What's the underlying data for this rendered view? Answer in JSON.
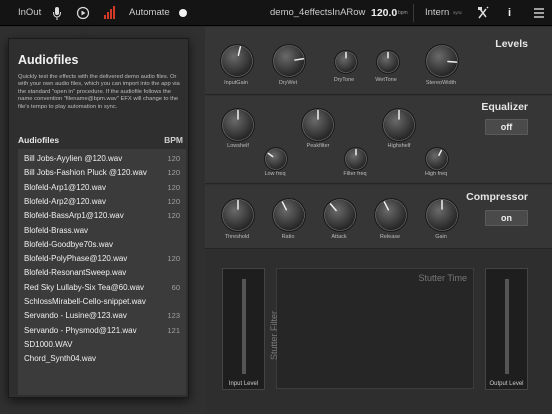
{
  "topbar": {
    "inout": "InOut",
    "automate": "Automate",
    "project": "demo_4effectsInARow",
    "bpm_value": "120.0",
    "bpm_unit": "bpm",
    "sync_label": "Intern",
    "sync_sub": "sync",
    "info": "i",
    "colors": {
      "record": "#d23a2a",
      "bar": "#141414"
    }
  },
  "levels": {
    "title": "Levels",
    "knobs": [
      {
        "label": "InputGain",
        "value": 0.55
      },
      {
        "label": "DryWet",
        "value": 0.8
      },
      {
        "label": "DryTone",
        "value": 0.5
      },
      {
        "label": "WetTone",
        "value": 0.5
      },
      {
        "label": "StereoWidth",
        "value": 0.85
      }
    ]
  },
  "equalizer": {
    "title": "Equalizer",
    "toggle": "off",
    "knobs": [
      {
        "label": "Lowshelf",
        "value": 0.5
      },
      {
        "label": "Peakfilter",
        "value": 0.5
      },
      {
        "label": "Highshelf",
        "value": 0.5
      },
      {
        "label": "Low freq",
        "value": 0.3
      },
      {
        "label": "Filter freq",
        "value": 0.5
      },
      {
        "label": "High freq",
        "value": 0.6
      }
    ]
  },
  "compressor": {
    "title": "Compressor",
    "toggle": "on",
    "knobs": [
      {
        "label": "Threshold",
        "value": 0.5
      },
      {
        "label": "Ratio",
        "value": 0.4
      },
      {
        "label": "Attack",
        "value": 0.35
      },
      {
        "label": "Release",
        "value": 0.4
      },
      {
        "label": "Gain",
        "value": 0.5
      }
    ]
  },
  "stutter": {
    "time_label": "Stutter Time",
    "filter_label": "Stutter Filter",
    "input_level": "Input Level",
    "output_level": "Output Level"
  },
  "audiofiles": {
    "title": "Audiofiles",
    "description": "Quickly test the effects with the delivered demo audio files. Or with your own audio files, which you can import into the app via the standard \"open in\" procedure. If the audiofile follows the name convention \"filename@bpm.wav\" EFX will change to the file's tempo to play automation in sync.",
    "col_name": "Audiofiles",
    "col_bpm": "BPM",
    "files": [
      {
        "name": "Bill Jobs-Ayylien @120.wav",
        "bpm": "120"
      },
      {
        "name": "Bill Jobs-Fashion Pluck @120.wav",
        "bpm": "120"
      },
      {
        "name": "Blofeld-Arp1@120.wav",
        "bpm": "120"
      },
      {
        "name": "Blofeld-Arp2@120.wav",
        "bpm": "120"
      },
      {
        "name": "Blofeld-BassArp1@120.wav",
        "bpm": "120"
      },
      {
        "name": "Blofeld-Brass.wav",
        "bpm": ""
      },
      {
        "name": "Blofeld-Goodbye70s.wav",
        "bpm": ""
      },
      {
        "name": "Blofeld-PolyPhase@120.wav",
        "bpm": "120"
      },
      {
        "name": "Blofeld-ResonantSweep.wav",
        "bpm": ""
      },
      {
        "name": "Red Sky Lullaby-Six Tea@60.wav",
        "bpm": "60"
      },
      {
        "name": "SchlossMirabell-Cello-snippet.wav",
        "bpm": ""
      },
      {
        "name": "Servando - Lusine@123.wav",
        "bpm": "123"
      },
      {
        "name": "Servando - Physmod@121.wav",
        "bpm": "121"
      },
      {
        "name": "SD1000.WAV",
        "bpm": ""
      },
      {
        "name": "Chord_Synth04.wav",
        "bpm": ""
      }
    ]
  }
}
